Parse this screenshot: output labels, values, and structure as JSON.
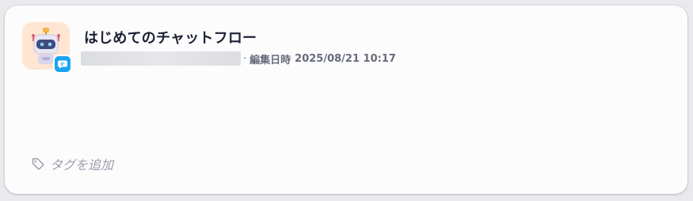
{
  "card": {
    "title": "はじめてのチャットフロー",
    "meta": {
      "separator": "·",
      "edited_label": "編集日時",
      "edited_date": "2025/08/21 10:17"
    },
    "add_tag_label": "タグを追加"
  },
  "icons": {
    "app": "robot-icon",
    "badge": "chat-bubble-icon",
    "tag": "tag-icon"
  },
  "colors": {
    "icon_background": "#ffe6d2",
    "badge": "#1aa3f0",
    "title": "#1c2033",
    "muted": "#9a9dab"
  }
}
